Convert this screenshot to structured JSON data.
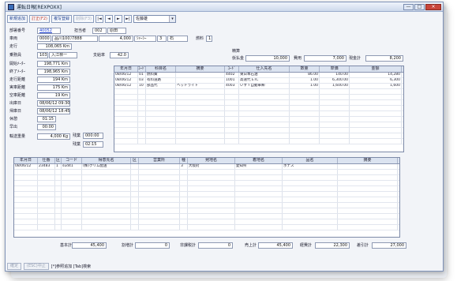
{
  "window": {
    "title": "運転日報[REXPOXX]",
    "controls": [
      "—",
      "□",
      "×"
    ]
  },
  "toolbar": {
    "new": "新規追加",
    "edit": "訂正(F2)",
    "copy": "複写登録",
    "delete": "削除(F3)",
    "nav": [
      "|◄",
      "◄",
      "►",
      "►|"
    ],
    "driver_combo": "佐藤雄"
  },
  "header": {
    "dept_no_label": "部署番号",
    "dept_no": "40052",
    "vehicle_label": "車両",
    "vehicle_no": "0000",
    "vehicle_name": "品川100ﾌ7888",
    "vehicle_weight": "4,000",
    "vehicle_type": "ｼｬｰｼｰ",
    "vehicle_extra": "3",
    "vehicle_sub": "石",
    "capacity_label": "燃料",
    "capacity": "1",
    "office_label": "担当者",
    "office_code": "002",
    "office_name": "原田",
    "distance_label": "走行",
    "distance": "108,065 Km",
    "crew_label": "乗務員",
    "crew_code": "103",
    "crew_name": "入江林一",
    "rate_label": "支給率",
    "rate": "42.0"
  },
  "metrics": [
    {
      "label": "開始ﾒｰﾀｰ",
      "value": "198,771 Km"
    },
    {
      "label": "終了ﾒｰﾀｰ",
      "value": "198,965 Km"
    },
    {
      "label": "走行距離",
      "value": "194 Km"
    },
    {
      "label": "実車距離",
      "value": "175 Km"
    },
    {
      "label": "空車距離",
      "value": "19 Km"
    },
    {
      "label": "出庫日",
      "value": "08/06/12 09:30"
    },
    {
      "label": "帰庫日",
      "value": "08/06/12 18:45"
    },
    {
      "label": "休憩",
      "value": "01:15"
    },
    {
      "label": "早出",
      "value": "00:00"
    },
    {
      "label": "輸送重量",
      "value": "4,000 Kg"
    }
  ],
  "extra_times": [
    {
      "label": "残業",
      "value": "000:00"
    },
    {
      "label": "残業",
      "value": "02:15"
    }
  ],
  "totals_box": {
    "title": "精算",
    "advance_label": "仮払金",
    "advance": "10,000",
    "expense_label": "費用",
    "expense": "7,000",
    "cash_label": "現金計",
    "cash": "8,200"
  },
  "expense_grid": {
    "columns": [
      "年月日",
      "ｺｰﾄﾞ",
      "科目名",
      "摘要",
      "ｺｰﾄﾞ",
      "仕入先名",
      "数量",
      "単価",
      "金額"
    ],
    "rows": [
      [
        "08/06/12",
        "01",
        "燃料費",
        "",
        "4402",
        "東日本石油",
        "86.00",
        "140.00",
        "14,280"
      ],
      [
        "08/06/12",
        "03",
        "有料道路",
        "",
        "1001",
        "高速代 ETC",
        "1.00",
        "6,300.00",
        "6,300"
      ],
      [
        "08/06/12",
        "10",
        "部品代",
        "ヘッドライト",
        "4003",
        "いすゞ自動車㈱",
        "1.00",
        "1,600.00",
        "1,600"
      ]
    ]
  },
  "delivery_grid": {
    "columns": [
      "年月日",
      "仕番",
      "区",
      "コード",
      "得意先名",
      "区",
      "営業所",
      "種",
      "発地名",
      "着地名",
      "品名",
      "摘要"
    ],
    "rows": [
      [
        "08/06/12",
        "23483",
        "1",
        "sud41",
        "(株)クリム配送",
        "",
        "",
        "3",
        "大阪府",
        "愛知県",
        "ホナス",
        ""
      ]
    ]
  },
  "footer_totals": [
    {
      "label": "基本計",
      "value": "45,400"
    },
    {
      "label": "割増計",
      "value": "0"
    },
    {
      "label": "非課税計",
      "value": "0"
    },
    {
      "label": "売上計",
      "value": "45,400"
    },
    {
      "label": "経費計",
      "value": "22,300"
    },
    {
      "label": "差引計",
      "value": "27,000"
    }
  ],
  "statusbar": {
    "btn1": "確定",
    "btn2": "(ESC)中止",
    "hint": "[*]参照追加 [Tab]検索"
  },
  "colors": {
    "accent": "#1a3dd0",
    "header_bg": "#dbe3f0",
    "window_border": "#7f93b8"
  }
}
